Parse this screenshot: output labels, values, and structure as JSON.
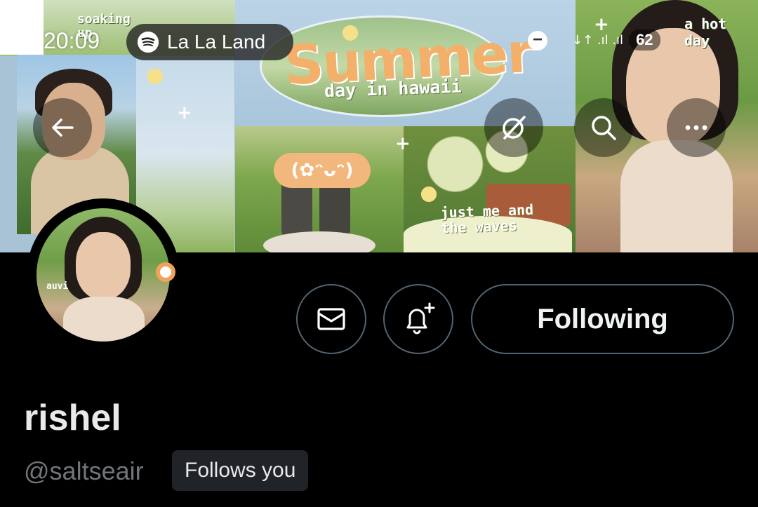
{
  "status_bar": {
    "time": "20:09",
    "battery": "62",
    "icons": "↓↑ .ıl .ıl"
  },
  "banner": {
    "title_main": "Summer",
    "title_sub": "day in hawaii",
    "kaomoji": "(✿ᵔᴗᵔ)",
    "caption_waves": "just me and\nthe waves",
    "caption_hot": "a hot\nday",
    "caption_soaking": "soaking\nup"
  },
  "music": {
    "title": "La La Land",
    "icon": "spotify-icon"
  },
  "nav": {
    "back_icon": "arrow-left-icon",
    "grok_icon": "grok-icon",
    "search_icon": "search-icon",
    "more_icon": "more-horizontal-icon"
  },
  "actions": {
    "message_icon": "mail-icon",
    "notify_icon": "bell-plus-icon",
    "following_label": "Following"
  },
  "profile": {
    "display_name": "rishel",
    "handle": "@saltseair",
    "follows_you": "Follows you",
    "avatar_tag": "auvi"
  },
  "colors": {
    "background": "#000000",
    "border": "#536471",
    "muted_text": "#71767b",
    "badge_bg": "#202327"
  }
}
